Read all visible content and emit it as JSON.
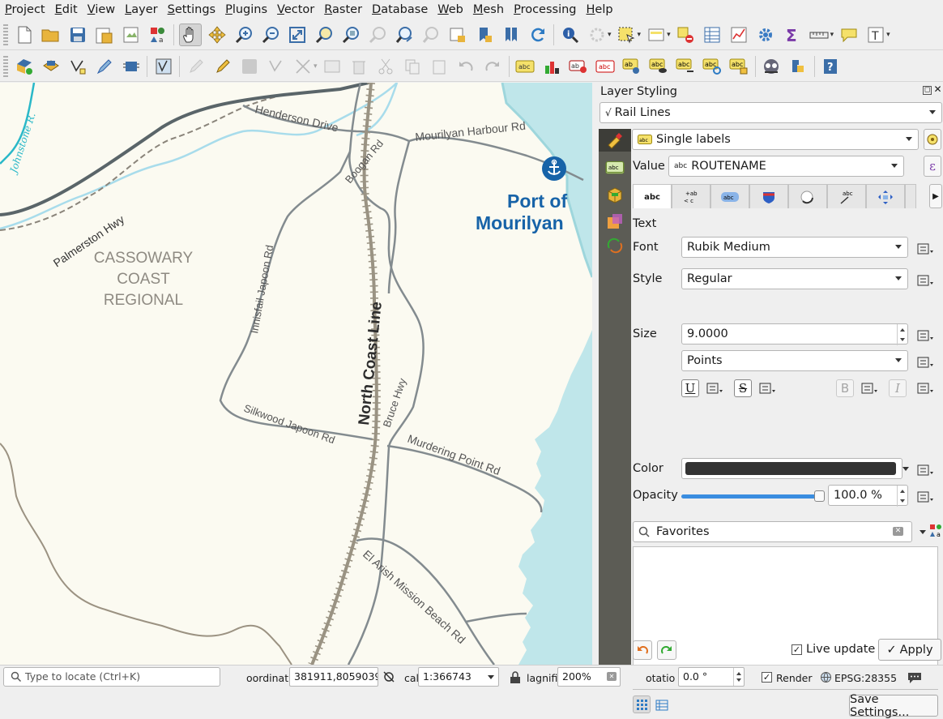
{
  "menu": [
    "Project",
    "Edit",
    "View",
    "Layer",
    "Settings",
    "Plugins",
    "Vector",
    "Raster",
    "Database",
    "Web",
    "Mesh",
    "Processing",
    "Help"
  ],
  "map": {
    "river_label": "Johnstone R.",
    "roads": {
      "palmerston": "Palmerston Hwy",
      "henderson": "Henderson Drive",
      "mourilyan_harbour": "Mourilyan Harbour Rd",
      "boogan": "Boogan Rd",
      "innisfail_japoon": "Innisfail Japoon Rd",
      "bruce": "Bruce Hwy",
      "silkwood": "Silkwood Japoon Rd",
      "murdering_point": "Murdering Point Rd",
      "el_arish": "El Arish Mission Beach Rd"
    },
    "rail": "North Coast Line",
    "region": [
      "CASSOWARY",
      "COAST",
      "REGIONAL"
    ],
    "port": [
      "Port of",
      "Mourilyan"
    ],
    "colors": {
      "land": "#fbfaf1",
      "water": "#bfe6ea",
      "port": "#1763a8",
      "road": "#7f8a8e",
      "rail": "#9a9383"
    }
  },
  "panel": {
    "title": "Layer Styling",
    "layer": "Rail Lines",
    "mode": "Single labels",
    "value_label": "Value",
    "value": "ROUTENAME",
    "section": "Text",
    "font_label": "Font",
    "font": "Rubik Medium",
    "style_label": "Style",
    "style": "Regular",
    "size_label": "Size",
    "size": "9.0000",
    "unit": "Points",
    "color_label": "Color",
    "color": "#333333",
    "opacity_label": "Opacity",
    "opacity": "100.0 %",
    "opacity_value": 1.0,
    "search_placeholder": "Favorites",
    "save_settings": "Save Settings...",
    "live_update": "Live update",
    "apply": "Apply",
    "tab_text": "abc"
  },
  "status": {
    "locate_placeholder": "Type to locate (Ctrl+K)",
    "coord_label": "oordinat",
    "coord": "381911,8059039",
    "scale_label": "cal",
    "scale": "1:366743",
    "magnifier_label": "lagnifie",
    "magnifier": "200%",
    "rotation_label": "otatio",
    "rotation": "0.0 °",
    "render": "Render",
    "crs": "EPSG:28355"
  }
}
